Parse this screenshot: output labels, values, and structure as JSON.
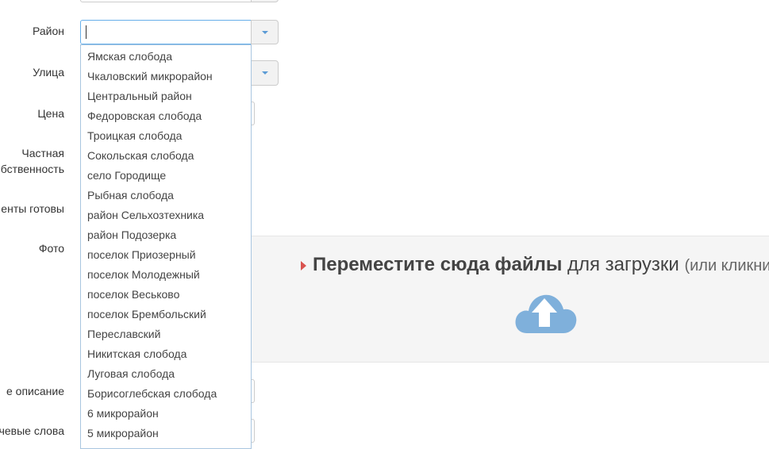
{
  "form": {
    "labels": {
      "district": "Район",
      "street": "Улица",
      "price": "Цена",
      "private_line1": "Частная",
      "private_line2": "бственность",
      "documents": "енты готовы",
      "photo": "Фото",
      "description": "е описание",
      "keywords": "чевые слова"
    },
    "district": {
      "value": "",
      "options": [
        "Ямская слобода",
        "Чкаловский микрорайон",
        "Центральный район",
        "Федоровская слобода",
        "Троицкая слобода",
        "Сокольская слобода",
        "село Городище",
        "Рыбная слобода",
        "район Сельхозтехника",
        "район Подозерка",
        "поселок Приозерный",
        "поселок Молодежный",
        "поселок Веськово",
        "поселок Брембольский",
        "Переславский",
        "Никитская слобода",
        "Луговая слобода",
        "Борисоглебская слобода",
        "6 микрорайон",
        "5 микрорайон"
      ]
    }
  },
  "upload": {
    "prefix_strong": "Переместите сюда файлы",
    "middle": " для загрузки ",
    "hint": "(или кликните",
    "icon": "cloud-upload-icon"
  },
  "colors": {
    "accent": "#66afe9",
    "cloud": "#7fb0db",
    "arrow": "#d9534f"
  }
}
